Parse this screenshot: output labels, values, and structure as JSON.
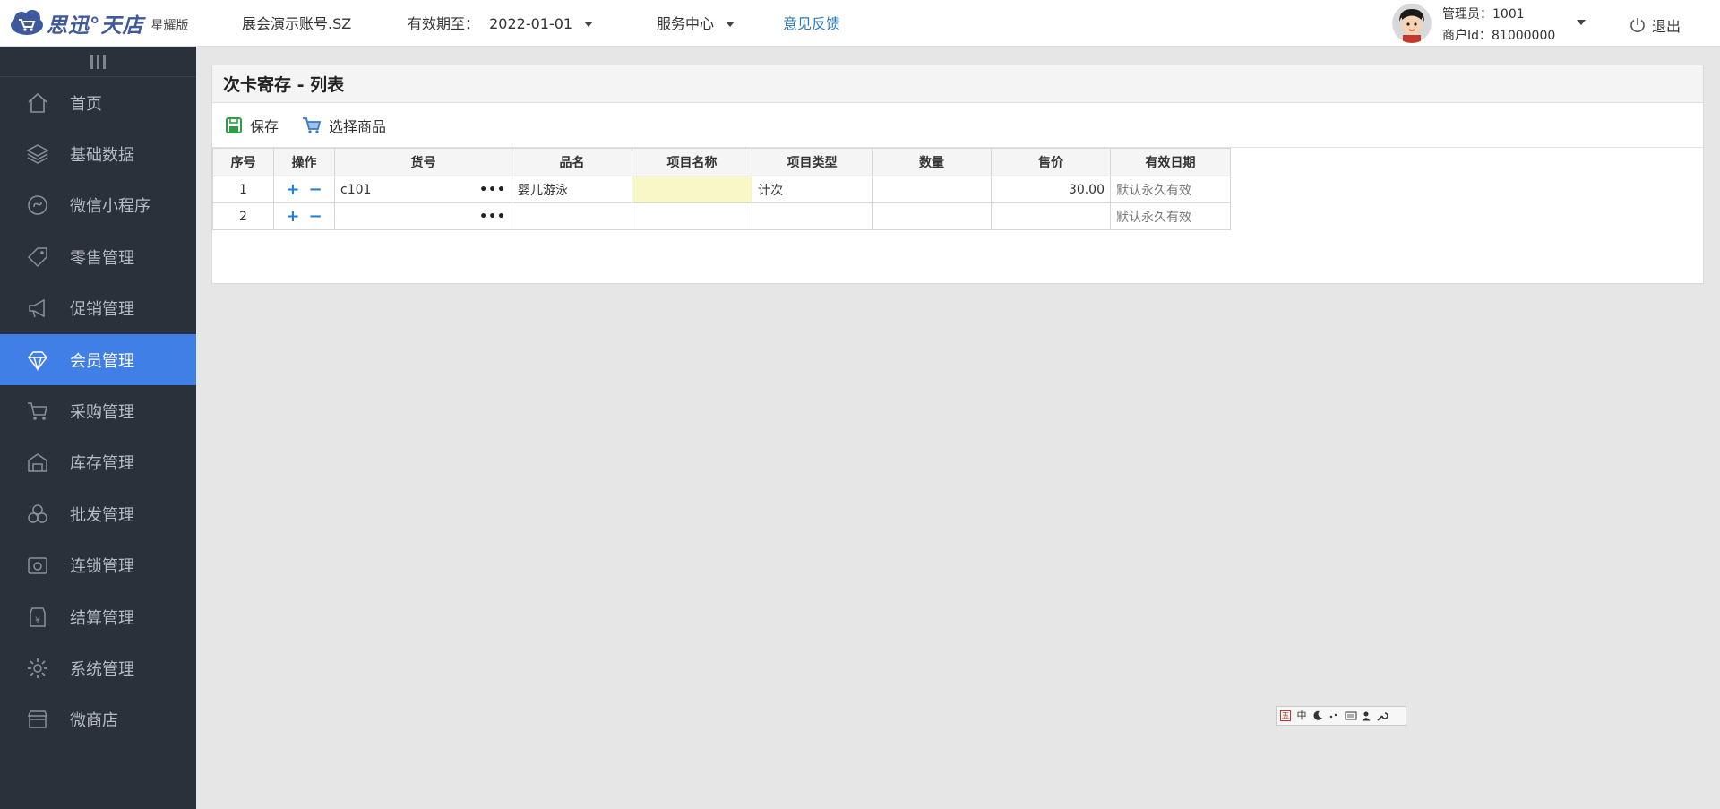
{
  "header": {
    "brand": "思迅°天店",
    "edition": "星耀版",
    "account": "展会演示账号.SZ",
    "expiry_label": "有效期至：",
    "expiry_value": "2022-01-01",
    "service_center": "服务中心",
    "feedback": "意见反馈",
    "admin": "管理员：1001",
    "merchant": "商户Id：81000000",
    "logout": "退出"
  },
  "sidebar": {
    "items": [
      {
        "label": "首页",
        "icon": "home-icon"
      },
      {
        "label": "基础数据",
        "icon": "layers-icon"
      },
      {
        "label": "微信小程序",
        "icon": "mini-program-icon"
      },
      {
        "label": "零售管理",
        "icon": "tag-icon"
      },
      {
        "label": "促销管理",
        "icon": "megaphone-icon"
      },
      {
        "label": "会员管理",
        "icon": "diamond-icon",
        "active": true
      },
      {
        "label": "采购管理",
        "icon": "cart-icon"
      },
      {
        "label": "库存管理",
        "icon": "warehouse-icon"
      },
      {
        "label": "批发管理",
        "icon": "boxes-icon"
      },
      {
        "label": "连锁管理",
        "icon": "chain-store-icon"
      },
      {
        "label": "结算管理",
        "icon": "settlement-icon"
      },
      {
        "label": "系统管理",
        "icon": "gear-icon"
      },
      {
        "label": "微商店",
        "icon": "shop-icon"
      }
    ]
  },
  "main": {
    "title": "次卡寄存 - 列表",
    "toolbar": {
      "save": "保存",
      "select_goods": "选择商品"
    },
    "table": {
      "columns": [
        "序号",
        "操作",
        "货号",
        "品名",
        "项目名称",
        "项目类型",
        "数量",
        "售价",
        "有效日期"
      ],
      "rows": [
        {
          "index": "1",
          "code": "c101",
          "name": "婴儿游泳",
          "item_name": "",
          "item_type": "计次",
          "qty": "",
          "price": "30.00",
          "valid": "默认永久有效"
        },
        {
          "index": "2",
          "code": "",
          "name": "",
          "item_name": "",
          "item_type": "",
          "qty": "",
          "price": "",
          "valid": "默认永久有效"
        }
      ],
      "more_symbol": "•••",
      "add_symbol": "+",
      "remove_symbol": "−"
    }
  },
  "ime": {
    "label_5": "五",
    "label_zh": "中"
  },
  "colors": {
    "sidebar_bg": "#2b313b",
    "active_nav": "#3f7fe6",
    "link": "#2a7ab8",
    "highlight_cell": "#f7f7c8"
  }
}
